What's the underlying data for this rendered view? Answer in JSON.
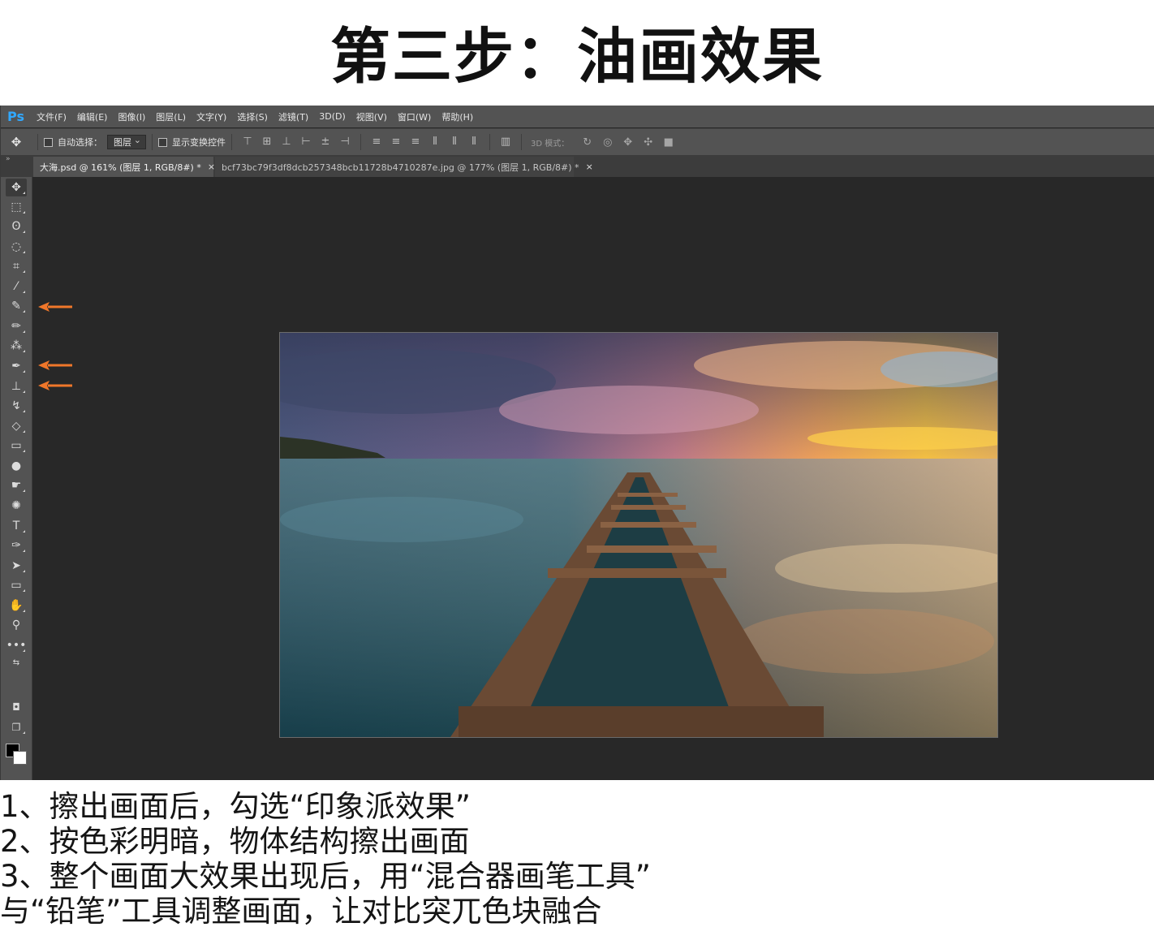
{
  "page": {
    "title": "第三步：油画效果",
    "caption_lines": [
      "1、擦出画面后，勾选“印象派效果”",
      "2、按色彩明暗，物体结构擦出画面",
      "3、整个画面大效果出现后，用“混合器画笔工具”",
      "与“铅笔”工具调整画面，让对比突兀色块融合"
    ]
  },
  "app": {
    "logo": "Ps",
    "menu": [
      "文件(F)",
      "编辑(E)",
      "图像(I)",
      "图层(L)",
      "文字(Y)",
      "选择(S)",
      "滤镜(T)",
      "3D(D)",
      "视图(V)",
      "窗口(W)",
      "帮助(H)"
    ],
    "options": {
      "auto_select_label": "自动选择：",
      "auto_select_value": "图层",
      "show_transform_label": "显示变换控件",
      "mode_3d_label": "3D 模式："
    },
    "tabs": [
      {
        "label": "大海.psd @ 161% (图层 1, RGB/8#) *",
        "close": "×",
        "active": true
      },
      {
        "label": "bcf73bc79f3df8dcb257348bcb11728b4710287e.jpg @ 177% (图层 1, RGB/8#) *",
        "close": "×",
        "active": false
      }
    ],
    "tools": [
      {
        "name": "move-tool",
        "glyph": "✥"
      },
      {
        "name": "marquee-tool",
        "glyph": "⬚"
      },
      {
        "name": "lasso-tool",
        "glyph": "ʘ"
      },
      {
        "name": "quick-selection-tool",
        "glyph": "◌"
      },
      {
        "name": "crop-tool",
        "glyph": "⌗"
      },
      {
        "name": "eyedropper-tool",
        "glyph": "⁄"
      },
      {
        "name": "brush-tool",
        "glyph": "✎"
      },
      {
        "name": "pencil-tool",
        "glyph": "✏"
      },
      {
        "name": "color-replacement-tool",
        "glyph": "⁂"
      },
      {
        "name": "mixer-brush-tool",
        "glyph": "✒"
      },
      {
        "name": "clone-stamp-tool",
        "glyph": "⊥"
      },
      {
        "name": "art-history-brush-tool",
        "glyph": "↯"
      },
      {
        "name": "eraser-tool",
        "glyph": "◇"
      },
      {
        "name": "gradient-tool",
        "glyph": "▭"
      },
      {
        "name": "blur-tool",
        "glyph": "●"
      },
      {
        "name": "smudge-tool",
        "glyph": "☛"
      },
      {
        "name": "sponge-tool",
        "glyph": "✺"
      },
      {
        "name": "type-tool",
        "glyph": "T"
      },
      {
        "name": "pen-tool",
        "glyph": "✑"
      },
      {
        "name": "path-selection-tool",
        "glyph": "➤"
      },
      {
        "name": "rectangle-tool",
        "glyph": "▭"
      },
      {
        "name": "hand-tool",
        "glyph": "✋"
      },
      {
        "name": "zoom-tool",
        "glyph": "⚲"
      },
      {
        "name": "more-tools",
        "glyph": "…"
      }
    ],
    "highlighted_tools": [
      "brush-tool",
      "mixer-brush-tool",
      "clone-stamp-tool"
    ],
    "arrow_color": "#f0772a",
    "accent_color": "#31a8ff"
  }
}
